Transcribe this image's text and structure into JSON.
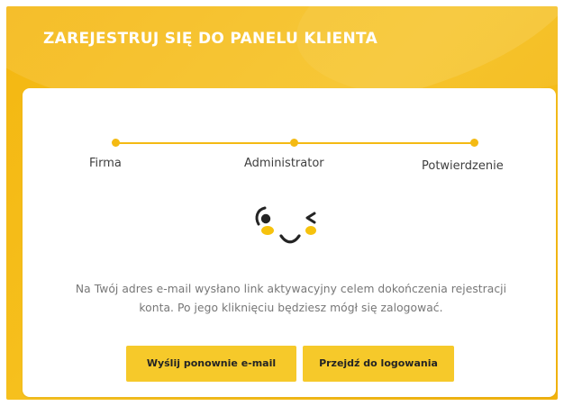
{
  "registration": {
    "title": "ZAREJESTRUJ SIĘ DO PANELU KLIENTA",
    "steps": [
      {
        "label": "Firma"
      },
      {
        "label": "Administrator"
      },
      {
        "label": "Potwierdzenie"
      }
    ],
    "illustration": "winking-face-icon",
    "message": "Na Twój adres e-mail wysłano link aktywacyjny celem dokończenia rejestracji konta. Po jego kliknięciu będziesz mógł się zalogować.",
    "buttons": {
      "resend_email": "Wyślij ponownie e-mail",
      "go_to_login": "Przejdź do logowania"
    }
  },
  "colors": {
    "accent": "#f4ba13",
    "button": "#f6c92a",
    "card": "#ffffff",
    "title_text": "#ffffff",
    "message_text": "#777777"
  }
}
